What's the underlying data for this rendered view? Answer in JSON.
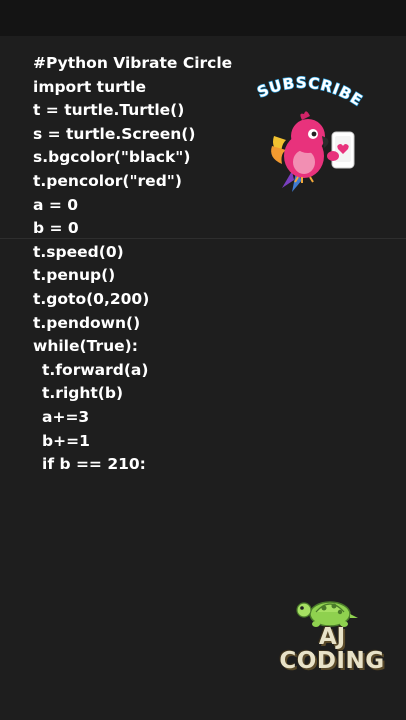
{
  "code": {
    "lines": [
      "#Python Vibrate Circle",
      "import turtle",
      "t = turtle.Turtle()",
      "s = turtle.Screen()",
      "s.bgcolor(\"black\")",
      "t.pencolor(\"red\")",
      "a = 0",
      "b = 0",
      "t.speed(0)",
      "t.penup()",
      "t.goto(0,200)",
      "t.pendown()",
      "while(True):",
      "t.forward(a)",
      "t.right(b)",
      "a+=3",
      "b+=1",
      "if b == 210:"
    ]
  },
  "sticker": {
    "subscribe_text": "SUBSCRIBE",
    "icon": "parrot-with-phone-icon"
  },
  "logo": {
    "line1": "AJ",
    "line2": "CODING",
    "icon": "turtle-icon"
  },
  "colors": {
    "background": "#1e1e1e",
    "code_text": "#ffffff",
    "subscribe_outline": "#2aa6e8"
  }
}
